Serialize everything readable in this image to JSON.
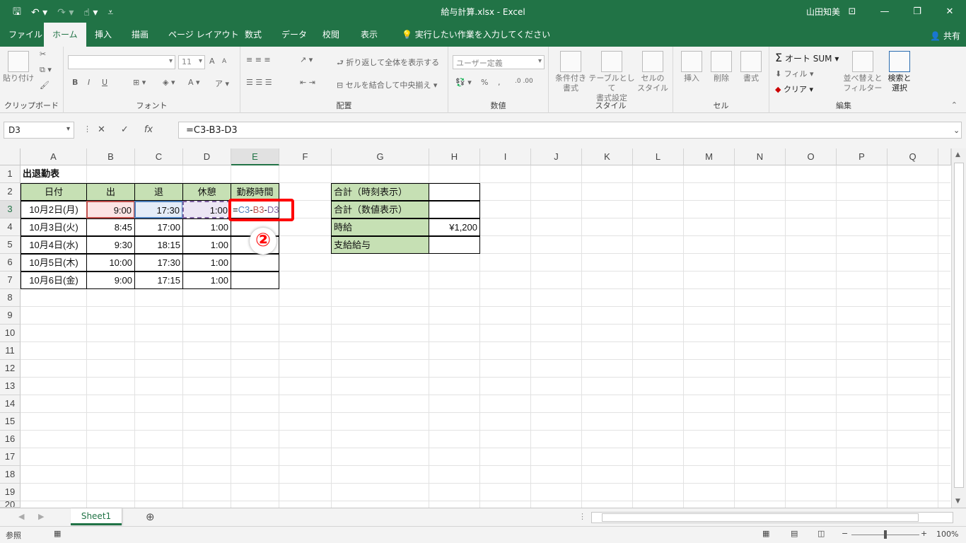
{
  "window": {
    "title": "給与計算.xlsx  -  Excel",
    "user": "山田知美",
    "qat_icons": [
      "save-icon",
      "undo-icon",
      "redo-icon",
      "touch-mode-icon",
      "customize-icon"
    ],
    "controls": {
      "restore_ribbon": "⊡",
      "minimize": "—",
      "maximize": "❐",
      "close": "✕"
    }
  },
  "ribbon_tabs": [
    "ファイル",
    "ホーム",
    "挿入",
    "描画",
    "ページ レイアウト",
    "数式",
    "データ",
    "校閲",
    "表示",
    "実行したい作業を入力してください"
  ],
  "share_label": "共有",
  "ribbon": {
    "clipboard": {
      "label": "クリップボード",
      "paste": "貼り付け"
    },
    "font": {
      "label": "フォント",
      "font_name": "",
      "font_size": "11",
      "bold": "B",
      "italic": "I",
      "underline": "U",
      "grow": "A",
      "shrink": "A"
    },
    "alignment": {
      "label": "配置",
      "wrap": "折り返して全体を表示する",
      "merge": "セルを結合して中央揃え"
    },
    "number": {
      "label": "数値",
      "format": "ユーザー定義",
      "percent": "%",
      "comma": ","
    },
    "styles": {
      "label": "スタイル",
      "conditional": [
        "条件付き",
        "書式"
      ],
      "table": [
        "テーブルとして",
        "書式設定"
      ],
      "cell_styles": [
        "セルの",
        "スタイル"
      ]
    },
    "cells": {
      "label": "セル",
      "insert": "挿入",
      "delete": "削除",
      "format": "書式"
    },
    "editing": {
      "label": "編集",
      "autosum": "オート SUM",
      "fill": "フィル",
      "clear": "クリア",
      "sort": [
        "並べ替えと",
        "フィルター"
      ],
      "find": [
        "検索と",
        "選択"
      ]
    }
  },
  "formula_bar": {
    "name_box": "D3",
    "formula": "=C3-B3-D3",
    "fx": "fx",
    "cancel": "✕",
    "enter": "✓"
  },
  "columns": [
    "A",
    "B",
    "C",
    "D",
    "E",
    "F",
    "G",
    "H",
    "I",
    "J",
    "K",
    "L",
    "M",
    "N",
    "O",
    "P",
    "Q"
  ],
  "rows": [
    "1",
    "2",
    "3",
    "4",
    "5",
    "6",
    "7",
    "8",
    "9",
    "10",
    "11",
    "12",
    "13",
    "14",
    "15",
    "16",
    "17",
    "18",
    "19",
    "20"
  ],
  "sheet": {
    "title": "出退勤表",
    "headers": [
      "日付",
      "出",
      "退",
      "休憩",
      "勤務時間"
    ],
    "records": [
      {
        "date": "10月2日(月)",
        "in": "9:00",
        "out": "17:30",
        "break": "1:00"
      },
      {
        "date": "10月3日(火)",
        "in": "8:45",
        "out": "17:00",
        "break": "1:00"
      },
      {
        "date": "10月4日(水)",
        "in": "9:30",
        "out": "18:15",
        "break": "1:00"
      },
      {
        "date": "10月5日(木)",
        "in": "10:00",
        "out": "17:30",
        "break": "1:00"
      },
      {
        "date": "10月6日(金)",
        "in": "9:00",
        "out": "17:15",
        "break": "1:00"
      }
    ],
    "editing_formula": {
      "eq": "=",
      "c3": "C3",
      "m1": "-",
      "b3": "B3",
      "m2": "-",
      "d3": "D3"
    },
    "summary": [
      {
        "label": "合計（時刻表示）",
        "value": ""
      },
      {
        "label": "合計（数値表示）",
        "value": ""
      },
      {
        "label": "時給",
        "value": "¥1,200"
      },
      {
        "label": "支給給与",
        "value": ""
      }
    ]
  },
  "annotation": {
    "step": "②",
    "color": "#ff0000"
  },
  "sheet_tab": "Sheet1",
  "status": {
    "mode": "参照",
    "zoom": "100%"
  },
  "colors": {
    "excel_green": "#217346",
    "header_fill": "#c6e0b4",
    "ref_red": "#c0504d",
    "ref_blue": "#4f81bd",
    "ref_purple": "#8064a2"
  }
}
